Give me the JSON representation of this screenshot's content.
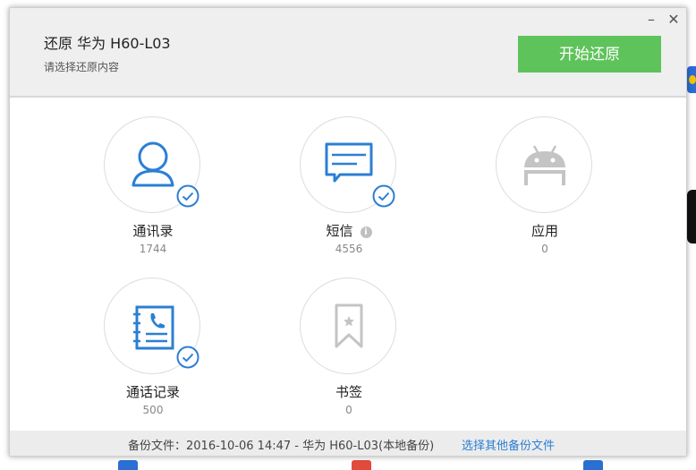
{
  "dialog": {
    "title": "还原 华为 H60-L03",
    "subtitle": "请选择还原内容",
    "start_button": "开始还原",
    "minimize": "–",
    "close": "✕"
  },
  "items": [
    {
      "label": "通讯录",
      "count": "1744",
      "icon": "contact-icon",
      "checked": true
    },
    {
      "label": "短信",
      "count": "4556",
      "icon": "message-icon",
      "checked": true,
      "info": "i"
    },
    {
      "label": "应用",
      "count": "0",
      "icon": "android-icon",
      "checked": false
    },
    {
      "label": "通话记录",
      "count": "500",
      "icon": "call-log-icon",
      "checked": true
    },
    {
      "label": "书签",
      "count": "0",
      "icon": "bookmark-icon",
      "checked": false
    }
  ],
  "footer": {
    "backup_file": "备份文件：2016-10-06 14:47 - 华为 H60-L03(本地备份)",
    "select_other": "选择其他备份文件"
  },
  "colors": {
    "accent_blue": "#2b7fd4",
    "green_button": "#5ec35b",
    "disabled_gray": "#c4c4c4"
  }
}
